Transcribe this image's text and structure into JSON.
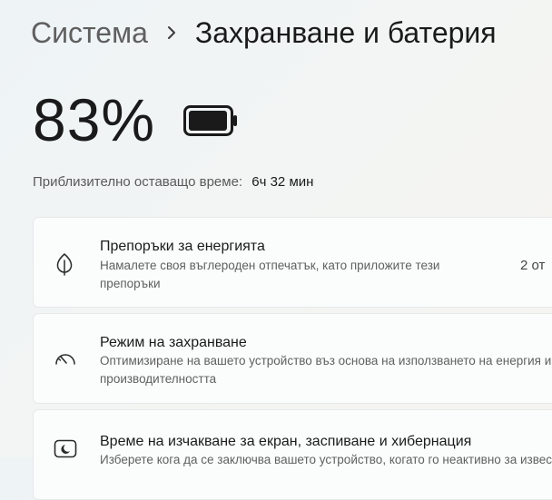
{
  "breadcrumb": {
    "parent": "Система",
    "current": "Захранване и батерия"
  },
  "battery": {
    "percent_text": "83%",
    "level": 83,
    "remaining_label": "Приблизително оставащо време:",
    "remaining_value": "6ч 32 мин"
  },
  "cards": [
    {
      "icon": "leaf-icon",
      "title": "Препоръки за енергията",
      "description": "Намалете своя въглероден отпечатък, като приложите тези препоръки",
      "right_text": "2 от"
    },
    {
      "icon": "gauge-icon",
      "title": "Режим на захранване",
      "description": "Оптимизиране на вашето устройство въз основа на използването на енергия и производителността"
    },
    {
      "icon": "screen-sleep-icon",
      "title": "Време на изчакване за екран, заспиване и хибернация",
      "description": "Изберете кога да се заключва вашето устройство, когато го неактивно за известно"
    }
  ]
}
